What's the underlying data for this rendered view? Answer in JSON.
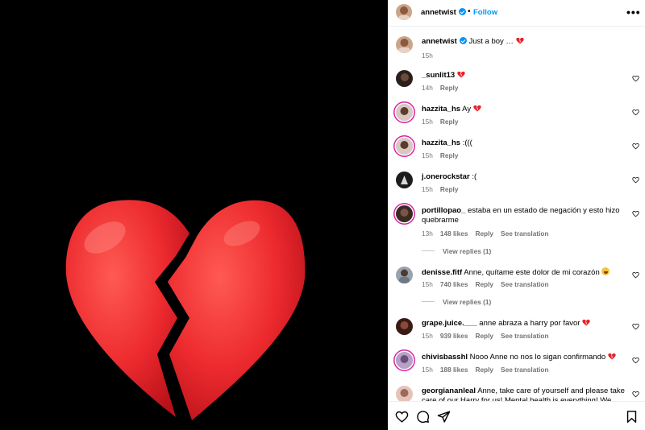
{
  "post": {
    "username": "annetwist",
    "follow_label": "Follow",
    "separator": "•",
    "more_label": "•••"
  },
  "caption": {
    "username": "annetwist",
    "text": "Just a boy …",
    "time": "15h"
  },
  "comments": [
    {
      "username": "_sunlit13",
      "text": "",
      "emoji": "broken-heart",
      "time": "14h",
      "likes": "",
      "reply": "Reply",
      "translate": "",
      "replies": ""
    },
    {
      "username": "hazzita_hs",
      "text": "Ay",
      "emoji": "broken-heart",
      "time": "15h",
      "likes": "",
      "reply": "Reply",
      "translate": "",
      "replies": ""
    },
    {
      "username": "hazzita_hs",
      "text": ":(((",
      "emoji": "",
      "time": "15h",
      "likes": "",
      "reply": "Reply",
      "translate": "",
      "replies": ""
    },
    {
      "username": "j.onerockstar",
      "text": ":(",
      "emoji": "",
      "time": "15h",
      "likes": "",
      "reply": "Reply",
      "translate": "",
      "replies": ""
    },
    {
      "username": "portillopao_",
      "text": "estaba en un estado de negación y esto hizo quebrarme",
      "emoji": "",
      "time": "13h",
      "likes": "148 likes",
      "reply": "Reply",
      "translate": "See translation",
      "replies": "View replies (1)"
    },
    {
      "username": "denisse.fitf",
      "text": "Anne, quítame este dolor de mi corazón",
      "emoji": "laugh-cry",
      "time": "15h",
      "likes": "740 likes",
      "reply": "Reply",
      "translate": "See translation",
      "replies": "View replies (1)"
    },
    {
      "username": "grape.juice.___",
      "text": "anne abraza a harry por favor",
      "emoji": "broken-heart",
      "time": "15h",
      "likes": "939 likes",
      "reply": "Reply",
      "translate": "See translation",
      "replies": ""
    },
    {
      "username": "chivisbasshl",
      "text": "Nooo Anne no nos lo sigan confirmando",
      "emoji": "broken-heart",
      "time": "15h",
      "likes": "188 likes",
      "reply": "Reply",
      "translate": "See translation",
      "replies": ""
    },
    {
      "username": "georgiananleal",
      "text": "Anne, take care of yourself and please take care of our Harry for us! Mental health is everything! We love",
      "emoji": "",
      "time": "",
      "likes": "",
      "reply": "",
      "translate": "",
      "replies": ""
    }
  ],
  "colors": {
    "accent": "#0095f6",
    "heart": "#e8222a",
    "meta": "#737373",
    "story_ring": "#d6249f"
  },
  "icons": {
    "media": "broken-heart-emoji",
    "actions": [
      "heart-outline-icon",
      "comment-icon",
      "share-icon",
      "bookmark-icon"
    ]
  }
}
